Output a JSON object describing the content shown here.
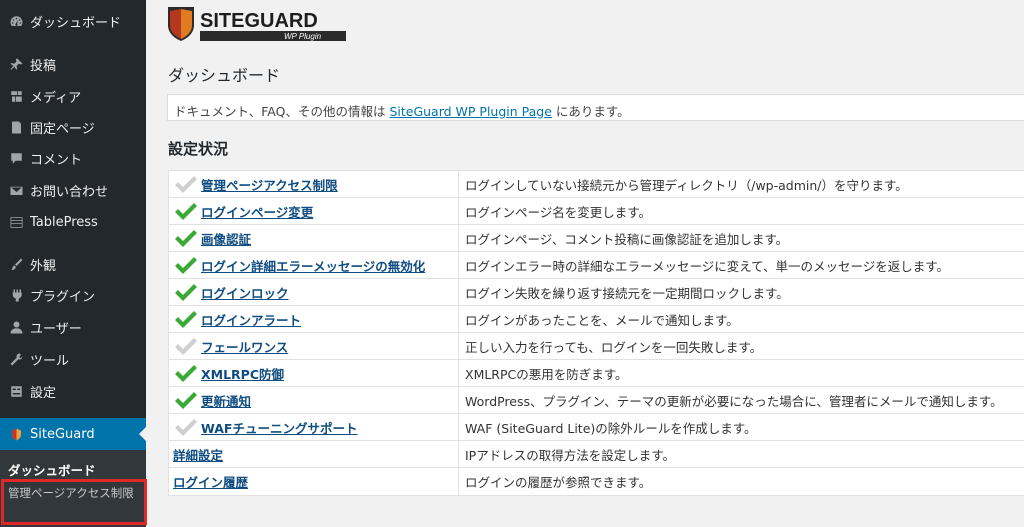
{
  "sidebar": {
    "items": [
      {
        "label": "ダッシュボード",
        "icon": "dashboard-icon"
      },
      {
        "label": "投稿",
        "icon": "pin-icon"
      },
      {
        "label": "メディア",
        "icon": "media-icon"
      },
      {
        "label": "固定ページ",
        "icon": "page-icon"
      },
      {
        "label": "コメント",
        "icon": "comment-icon"
      },
      {
        "label": "お問い合わせ",
        "icon": "mail-icon"
      },
      {
        "label": "TablePress",
        "icon": "table-icon"
      },
      {
        "label": "外観",
        "icon": "brush-icon"
      },
      {
        "label": "プラグイン",
        "icon": "plugin-icon"
      },
      {
        "label": "ユーザー",
        "icon": "user-icon"
      },
      {
        "label": "ツール",
        "icon": "wrench-icon"
      },
      {
        "label": "設定",
        "icon": "settings-icon"
      }
    ],
    "active": {
      "label": "SiteGuard",
      "icon": "siteguard-shield-icon"
    },
    "submenu": {
      "dashboard": "ダッシュボード",
      "admin_page": "管理ページアクセス制限"
    }
  },
  "logo": {
    "brand": "SITEGUARD",
    "sub": "WP Plugin"
  },
  "page_title": "ダッシュボード",
  "notice": {
    "prefix": "ドキュメント、FAQ、その他の情報は",
    "link": "SiteGuard WP Plugin Page",
    "suffix": "にあります。"
  },
  "status_title": "設定状況",
  "status_rows": [
    {
      "feature": "管理ページアクセス制限",
      "desc": "ログインしていない接続元から管理ディレクトリ（/wp-admin/）を守ります。",
      "check": "off"
    },
    {
      "feature": "ログインページ変更",
      "desc": "ログインページ名を変更します。",
      "check": "on"
    },
    {
      "feature": "画像認証",
      "desc": "ログインページ、コメント投稿に画像認証を追加します。",
      "check": "on"
    },
    {
      "feature": "ログイン詳細エラーメッセージの無効化",
      "desc": "ログインエラー時の詳細なエラーメッセージに変えて、単一のメッセージを返します。",
      "check": "on"
    },
    {
      "feature": "ログインロック",
      "desc": "ログイン失敗を繰り返す接続元を一定期間ロックします。",
      "check": "on"
    },
    {
      "feature": "ログインアラート",
      "desc": "ログインがあったことを、メールで通知します。",
      "check": "on"
    },
    {
      "feature": "フェールワンス",
      "desc": "正しい入力を行っても、ログインを一回失敗します。",
      "check": "off"
    },
    {
      "feature": "XMLRPC防御",
      "desc": "XMLRPCの悪用を防ぎます。",
      "check": "on"
    },
    {
      "feature": "更新通知",
      "desc": "WordPress、プラグイン、テーマの更新が必要になった場合に、管理者にメールで通知します。",
      "check": "on"
    },
    {
      "feature": "WAFチューニングサポート",
      "desc": "WAF (SiteGuard Lite)の除外ルールを作成します。",
      "check": "off"
    },
    {
      "feature": "詳細設定",
      "desc": "IPアドレスの取得方法を設定します。",
      "check": "none"
    },
    {
      "feature": "ログイン履歴",
      "desc": "ログインの履歴が参照できます。",
      "check": "none"
    }
  ],
  "colors": {
    "sidebar_bg": "#23282d",
    "active_bg": "#0073aa",
    "check_on": "#3aa935",
    "check_off": "#cfcfcf",
    "highlight_border": "#e02828"
  }
}
